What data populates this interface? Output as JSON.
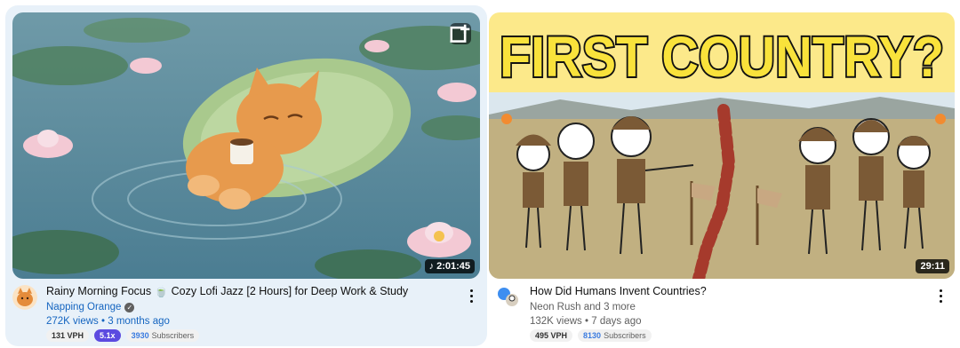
{
  "videos": [
    {
      "title": "Rainy Morning Focus 🍵 Cozy Lofi Jazz [2 Hours] for Deep Work & Study",
      "channel": "Napping Orange",
      "verified": true,
      "views_line": "272K views • 3 months ago",
      "duration": "2:01:45",
      "vph": "131 VPH",
      "multiplier": "5.1x",
      "subscribers_count": "3930",
      "subscribers_label": "Subscribers",
      "avatar_icon": "orange-cat-avatar",
      "overlay_icon": "add-to-playlist-icon"
    },
    {
      "title": "How Did Humans Invent Countries?",
      "channel": "Neon Rush and 3 more",
      "verified": false,
      "views_line": "132K views • 7 days ago",
      "duration": "29:11",
      "vph": "495 VPH",
      "subscribers_count": "8130",
      "subscribers_label": "Subscribers",
      "thumbnail_text": "FIRST COUNTRY?",
      "avatar_icon": "collab-avatar"
    }
  ],
  "colors": {
    "link_blue": "#1565c0",
    "multiplier_bg": "#5b4ae0",
    "subscribers_blue": "#3a7be0",
    "card_highlight": "#e8f1f9"
  }
}
